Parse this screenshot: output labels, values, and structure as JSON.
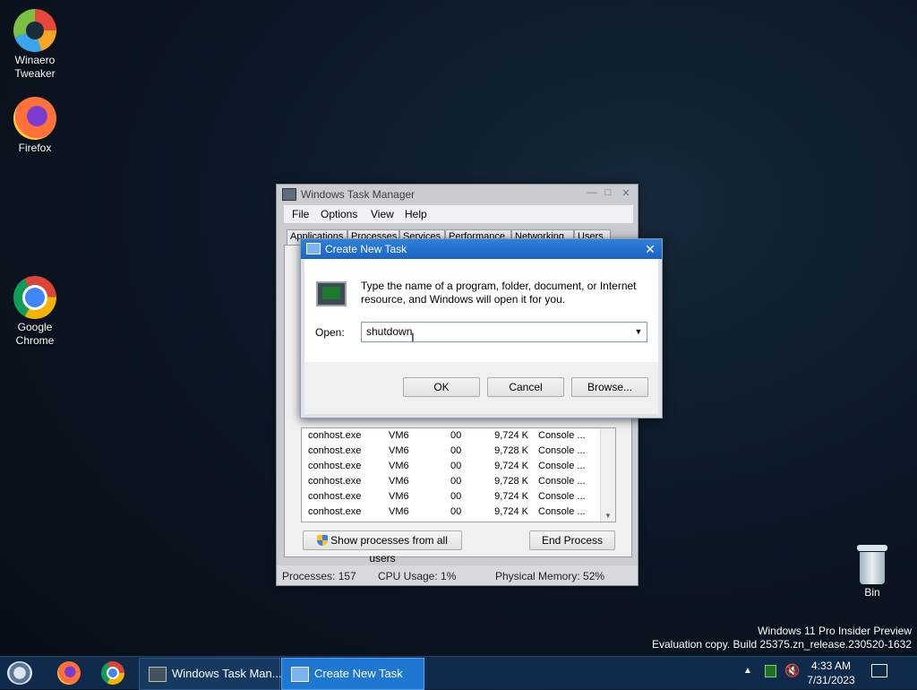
{
  "desktop": {
    "icons": [
      {
        "label_line1": "Winaero",
        "label_line2": "Tweaker",
        "icon": "winaero-icon"
      },
      {
        "label_line1": "Firefox",
        "label_line2": "",
        "icon": "firefox-icon"
      },
      {
        "label_line1": "Google",
        "label_line2": "Chrome",
        "icon": "chrome-icon"
      },
      {
        "label_line1": "Bin",
        "label_line2": "",
        "icon": "recycle-bin-icon"
      }
    ],
    "watermark": {
      "line1": "Windows 11 Pro Insider Preview",
      "line2": "Evaluation copy. Build 25375.zn_release.230520-1632"
    }
  },
  "task_manager": {
    "title": "Windows Task Manager",
    "menu": [
      "File",
      "Options",
      "View",
      "Help"
    ],
    "tabs": [
      "Applications",
      "Processes",
      "Services",
      "Performance",
      "Networking",
      "Users"
    ],
    "processes": [
      {
        "name": "conhost.exe",
        "user": "VM6",
        "cpu": "00",
        "memory": "9,724 K",
        "description": "Console ..."
      },
      {
        "name": "conhost.exe",
        "user": "VM6",
        "cpu": "00",
        "memory": "9,728 K",
        "description": "Console ..."
      },
      {
        "name": "conhost.exe",
        "user": "VM6",
        "cpu": "00",
        "memory": "9,724 K",
        "description": "Console ..."
      },
      {
        "name": "conhost.exe",
        "user": "VM6",
        "cpu": "00",
        "memory": "9,728 K",
        "description": "Console ..."
      },
      {
        "name": "conhost.exe",
        "user": "VM6",
        "cpu": "00",
        "memory": "9,724 K",
        "description": "Console ..."
      },
      {
        "name": "conhost.exe",
        "user": "VM6",
        "cpu": "00",
        "memory": "9,724 K",
        "description": "Console ..."
      }
    ],
    "show_all_label": "Show processes from all users",
    "end_process_label": "End Process",
    "status": {
      "processes": "Processes: 157",
      "cpu": "CPU Usage: 1%",
      "memory": "Physical Memory: 52%"
    }
  },
  "dialog": {
    "title": "Create New Task",
    "description": "Type the name of a program, folder, document, or Internet resource, and Windows will open it for you.",
    "open_label": "Open:",
    "open_value": "shutdown",
    "ok_label": "OK",
    "cancel_label": "Cancel",
    "browse_label": "Browse..."
  },
  "taskbar": {
    "tasks": [
      {
        "label": "Windows Task Man...",
        "active": false
      },
      {
        "label": "Create New Task",
        "active": true
      }
    ],
    "clock_time": "4:33 AM",
    "clock_date": "7/31/2023",
    "tray_icons": [
      "chevron-up-icon",
      "network-icon",
      "speaker-muted-icon",
      "notifications-icon"
    ]
  },
  "colors": {
    "dialog_title": "#1b64c4",
    "taskbar": "#0f2a4a",
    "active_task": "#1e77d0"
  }
}
